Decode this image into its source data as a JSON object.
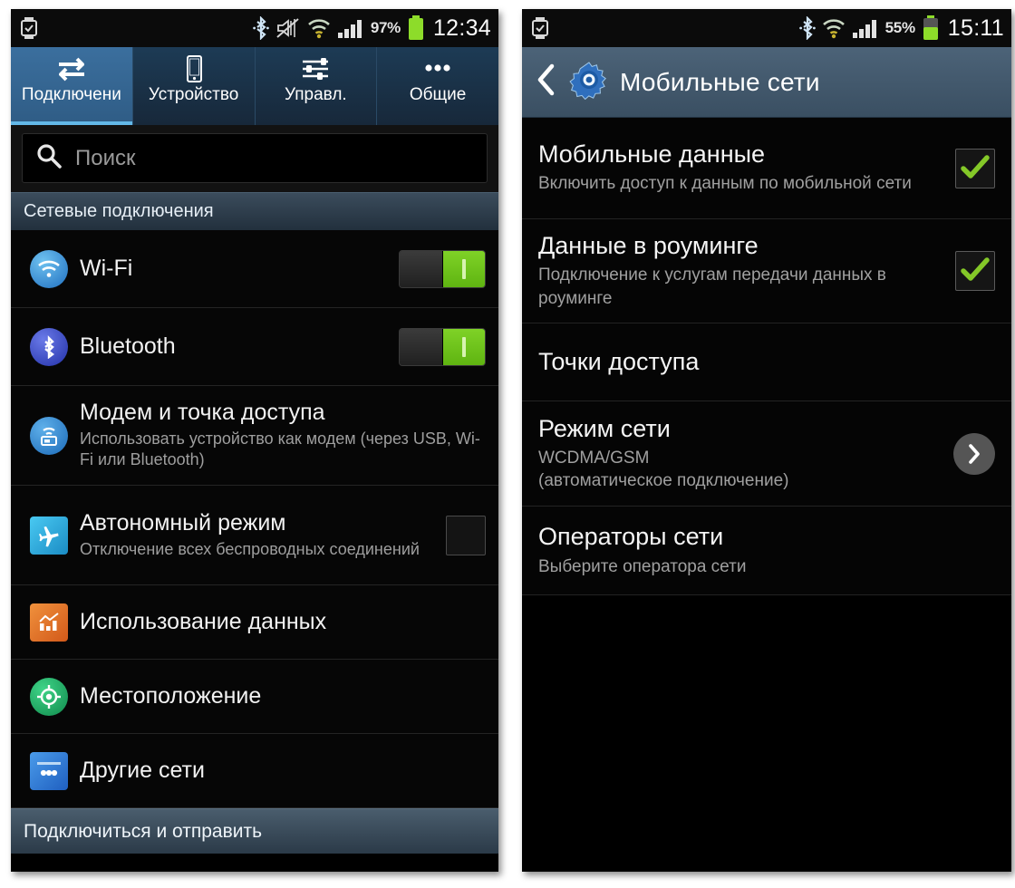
{
  "left_phone": {
    "statusbar": {
      "watch_icon": "smartwatch-icon",
      "bluetooth_icon": "bluetooth-icon",
      "mute_icon": "speaker-muted-icon",
      "wifi_icon": "wifi-icon",
      "signal_icon": "cellular-signal-icon",
      "battery_percent": "97%",
      "battery_icon": "battery-icon",
      "time": "12:34"
    },
    "tabs": [
      {
        "label": "Подключени",
        "icon": "connections-arrows-icon",
        "active": true
      },
      {
        "label": "Устройство",
        "icon": "phone-device-icon",
        "active": false
      },
      {
        "label": "Управл.",
        "icon": "sliders-icon",
        "active": false
      },
      {
        "label": "Общие",
        "icon": "more-dots-icon",
        "active": false
      }
    ],
    "search": {
      "icon": "search-icon",
      "placeholder": "Поиск",
      "value": ""
    },
    "section_header": "Сетевые подключения",
    "rows": [
      {
        "title": "Wi-Fi",
        "subtitle": "",
        "icon": "wifi-circle-icon",
        "icon_color": "#2f8fd8",
        "control": "toggle",
        "state": "on"
      },
      {
        "title": "Bluetooth",
        "subtitle": "",
        "icon": "bluetooth-circle-icon",
        "icon_color": "#3347c8",
        "control": "toggle",
        "state": "on"
      },
      {
        "title": "Модем и точка доступа",
        "subtitle": "Использовать устройство как модем (через USB, Wi-Fi или Bluetooth)",
        "icon": "tethering-hotspot-icon",
        "icon_color": "#2f7fd0",
        "control": "none",
        "state": ""
      },
      {
        "title": "Автономный режим",
        "subtitle": "Отключение всех беспроводных соединений",
        "icon": "airplane-icon",
        "icon_color": "#31b6e8",
        "control": "checkbox",
        "state": "off"
      },
      {
        "title": "Использование данных",
        "subtitle": "",
        "icon": "data-usage-chart-icon",
        "icon_color": "#e8772b",
        "control": "none",
        "state": ""
      },
      {
        "title": "Местоположение",
        "subtitle": "",
        "icon": "location-target-icon",
        "icon_color": "#19a05a",
        "control": "none",
        "state": ""
      },
      {
        "title": "Другие сети",
        "subtitle": "",
        "icon": "more-networks-icon",
        "icon_color": "#2f7fd0",
        "control": "none",
        "state": ""
      }
    ],
    "bottom_bar": "Подключиться и отправить"
  },
  "right_phone": {
    "statusbar": {
      "watch_icon": "smartwatch-icon",
      "bluetooth_icon": "bluetooth-icon",
      "wifi_icon": "wifi-icon",
      "signal_icon": "cellular-signal-icon",
      "battery_percent": "55%",
      "battery_icon": "battery-icon",
      "time": "15:11"
    },
    "header": {
      "back_icon": "back-chevron-icon",
      "app_icon": "settings-gear-icon",
      "title": "Мобильные сети"
    },
    "rows": [
      {
        "title": "Мобильные данные",
        "subtitle": "Включить доступ к данным по мобильной сети",
        "control": "checkbox",
        "state": "on"
      },
      {
        "title": "Данные в роуминге",
        "subtitle": "Подключение к услугам передачи данных в роуминге",
        "control": "checkbox",
        "state": "on"
      },
      {
        "title": "Точки доступа",
        "subtitle": "",
        "control": "none",
        "state": ""
      },
      {
        "title": "Режим сети",
        "subtitle": "WCDMA/GSM\n(автоматическое подключение)",
        "control": "chevron",
        "state": ""
      },
      {
        "title": "Операторы сети",
        "subtitle": "Выберите оператора сети",
        "control": "none",
        "state": ""
      }
    ]
  },
  "colors": {
    "accent_blue": "#3b6f9e",
    "toggle_green": "#6fc41a",
    "check_green": "#7ec225",
    "header_blue": "#4c6378"
  }
}
